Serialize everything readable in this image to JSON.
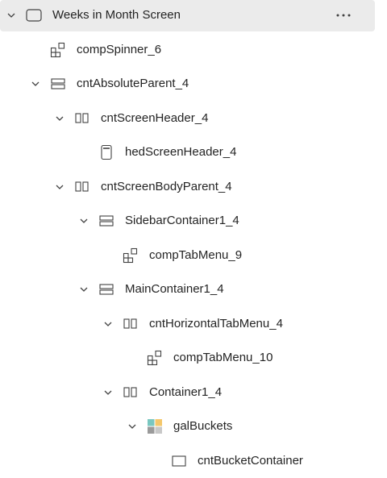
{
  "screen": {
    "label": "Weeks in Month Screen"
  },
  "nodes": [
    {
      "label": "compSpinner_6"
    },
    {
      "label": "cntAbsoluteParent_4"
    },
    {
      "label": "cntScreenHeader_4"
    },
    {
      "label": "hedScreenHeader_4"
    },
    {
      "label": "cntScreenBodyParent_4"
    },
    {
      "label": "SidebarContainer1_4"
    },
    {
      "label": "compTabMenu_9"
    },
    {
      "label": "MainContainer1_4"
    },
    {
      "label": "cntHorizontalTabMenu_4"
    },
    {
      "label": "compTabMenu_10"
    },
    {
      "label": "Container1_4"
    },
    {
      "label": "galBuckets"
    },
    {
      "label": "cntBucketContainer"
    }
  ],
  "icons": {
    "more": "more-options-icon"
  },
  "colors": {
    "selected_bg": "#ebebeb",
    "gallery_yellow": "#f4c76b",
    "gallery_teal": "#79c7c0",
    "gallery_gray": "#9a9a9a"
  }
}
